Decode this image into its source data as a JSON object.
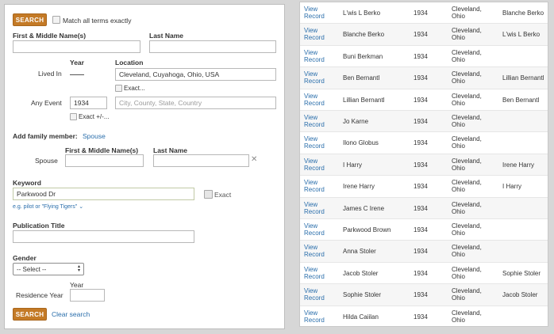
{
  "search_form": {
    "top_search_label": "SEARCH",
    "match_exact_label": "Match all terms exactly",
    "first_middle_label": "First & Middle Name(s)",
    "first_middle_value": "",
    "last_name_label": "Last Name",
    "last_name_value": "",
    "lived_in_label": "Lived In",
    "year_label": "Year",
    "year_dash": "——",
    "location_label": "Location",
    "location_value": "Cleveland, Cuyahoga, Ohio, USA",
    "location_exact_label": "Exact...",
    "any_event_label": "Any Event",
    "any_event_year": "1934",
    "any_event_location_placeholder": "City, County, State, Country",
    "any_event_exact_label": "Exact +/-...",
    "add_family_label": "Add family member:",
    "spouse_link": "Spouse",
    "spouse_label": "Spouse",
    "spouse_first_label": "First & Middle Name(s)",
    "spouse_last_label": "Last Name",
    "keyword_label": "Keyword",
    "keyword_value": "Parkwood Dr",
    "keyword_exact_label": "Exact",
    "keyword_hint": "e.g. pilot or \"Flying Tigers\"",
    "publication_title_label": "Publication Title",
    "gender_label": "Gender",
    "gender_selected": "-- Select --",
    "residence_year_label": "Residence Year",
    "residence_year_label_top": "Year",
    "bottom_search_label": "SEARCH",
    "clear_search_label": "Clear search"
  },
  "results": {
    "view_label": "View Record",
    "rows": [
      {
        "name": "L'wis L Berko",
        "year": "1934",
        "location": "Cleveland, Ohio",
        "related": "Blanche Berko"
      },
      {
        "name": "Blanche Berko",
        "year": "1934",
        "location": "Cleveland, Ohio",
        "related": "L'wis L Berko"
      },
      {
        "name": "Buni Berkman",
        "year": "1934",
        "location": "Cleveland, Ohio",
        "related": ""
      },
      {
        "name": "Ben Bernantl",
        "year": "1934",
        "location": "Cleveland, Ohio",
        "related": "Lillian Bernantl"
      },
      {
        "name": "Lillian Bernantl",
        "year": "1934",
        "location": "Cleveland, Ohio",
        "related": "Ben Bernantl"
      },
      {
        "name": "Jo Karne",
        "year": "1934",
        "location": "Cleveland, Ohio",
        "related": ""
      },
      {
        "name": "Ilono Globus",
        "year": "1934",
        "location": "Cleveland, Ohio",
        "related": ""
      },
      {
        "name": "I Harry",
        "year": "1934",
        "location": "Cleveland, Ohio",
        "related": "Irene Harry"
      },
      {
        "name": "Irene Harry",
        "year": "1934",
        "location": "Cleveland, Ohio",
        "related": "I Harry"
      },
      {
        "name": "James C Irene",
        "year": "1934",
        "location": "Cleveland, Ohio",
        "related": ""
      },
      {
        "name": "Parkwood Brown",
        "year": "1934",
        "location": "Cleveland, Ohio",
        "related": ""
      },
      {
        "name": "Anna Stoler",
        "year": "1934",
        "location": "Cleveland, Ohio",
        "related": ""
      },
      {
        "name": "Jacob Stoler",
        "year": "1934",
        "location": "Cleveland, Ohio",
        "related": "Sophie Stoler"
      },
      {
        "name": "Sophie Stoler",
        "year": "1934",
        "location": "Cleveland, Ohio",
        "related": "Jacob Stoler"
      },
      {
        "name": "Hilda Caiilan",
        "year": "1934",
        "location": "Cleveland, Ohio",
        "related": ""
      }
    ]
  },
  "colors": {
    "accent": "#c47a26",
    "link": "#2a6eab"
  }
}
